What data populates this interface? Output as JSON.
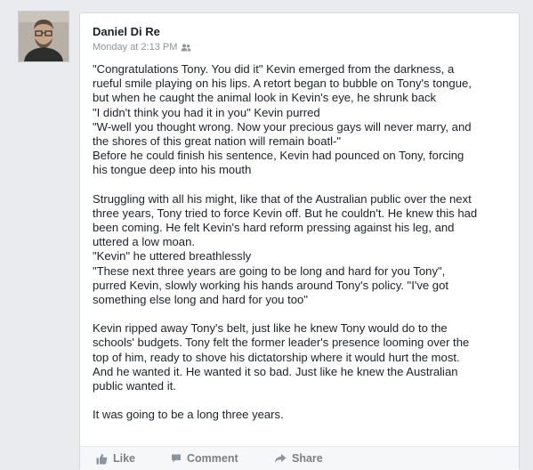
{
  "post": {
    "author": "Daniel Di Re",
    "timestamp": "Monday at 2:13 PM",
    "audience_icon": "friends-icon",
    "paragraphs": [
      [
        "\"Congratulations Tony. You did it\" Kevin emerged from the darkness, a",
        "rueful smile playing on his lips. A retort began to bubble on Tony's tongue,",
        "but when he caught the animal look in Kevin's eye, he shrunk back",
        "\"I didn't think you had it in you\" Kevin purred",
        "\"W-well you thought wrong. Now your precious gays will never marry, and",
        "the shores of this great nation will remain boatl-\"",
        "Before he could finish his sentence, Kevin had pounced on Tony, forcing",
        "his tongue deep into his mouth"
      ],
      [
        "Struggling with all his might, like that of the Australian public over the next",
        "three years, Tony tried to force Kevin off. But he couldn't. He knew this had",
        "been coming. He felt Kevin's hard reform pressing against his leg, and",
        "uttered a low moan.",
        "\"Kevin\" he uttered breathlessly",
        "\"These next three years are going to be long and hard for you Tony\",",
        "purred Kevin, slowly working his hands around Tony's policy. \"I've got",
        "something else long and hard for you too\""
      ],
      [
        "Kevin ripped away Tony's belt, just like he knew Tony would do to the",
        "schools' budgets. Tony felt the former leader's presence looming over the",
        "top of him, ready to shove his dictatorship where it would hurt the most.",
        "And he wanted it. He wanted it so bad. Just like he knew the Australian",
        "public wanted it."
      ],
      [
        "It was going to be a long three years."
      ]
    ]
  },
  "actions": {
    "like_label": "Like",
    "like_icon": "thumbs-up-icon",
    "comment_label": "Comment",
    "comment_icon": "comment-icon",
    "share_label": "Share",
    "share_icon": "share-icon"
  },
  "colors": {
    "author_text": "#1d2129",
    "meta_text": "#90949c",
    "action_text": "#7f7f7f",
    "page_bg": "#e9ebee"
  }
}
